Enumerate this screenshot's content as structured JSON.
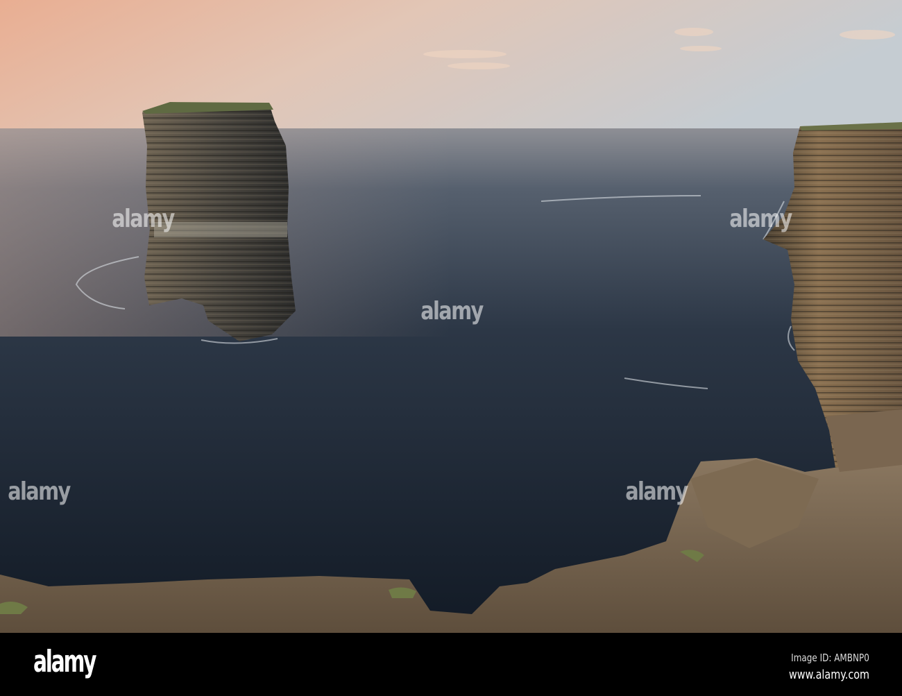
{
  "footer": {
    "logo": "alamy",
    "image_id": "Image ID: AMBNP0",
    "url": "www.alamy.com"
  },
  "watermark": "alamy",
  "colors": {
    "sky_warm": "#e9b89c",
    "sky_cool": "#c9cdd3",
    "sea": "#1e2733",
    "rock": "#6b5a45"
  }
}
